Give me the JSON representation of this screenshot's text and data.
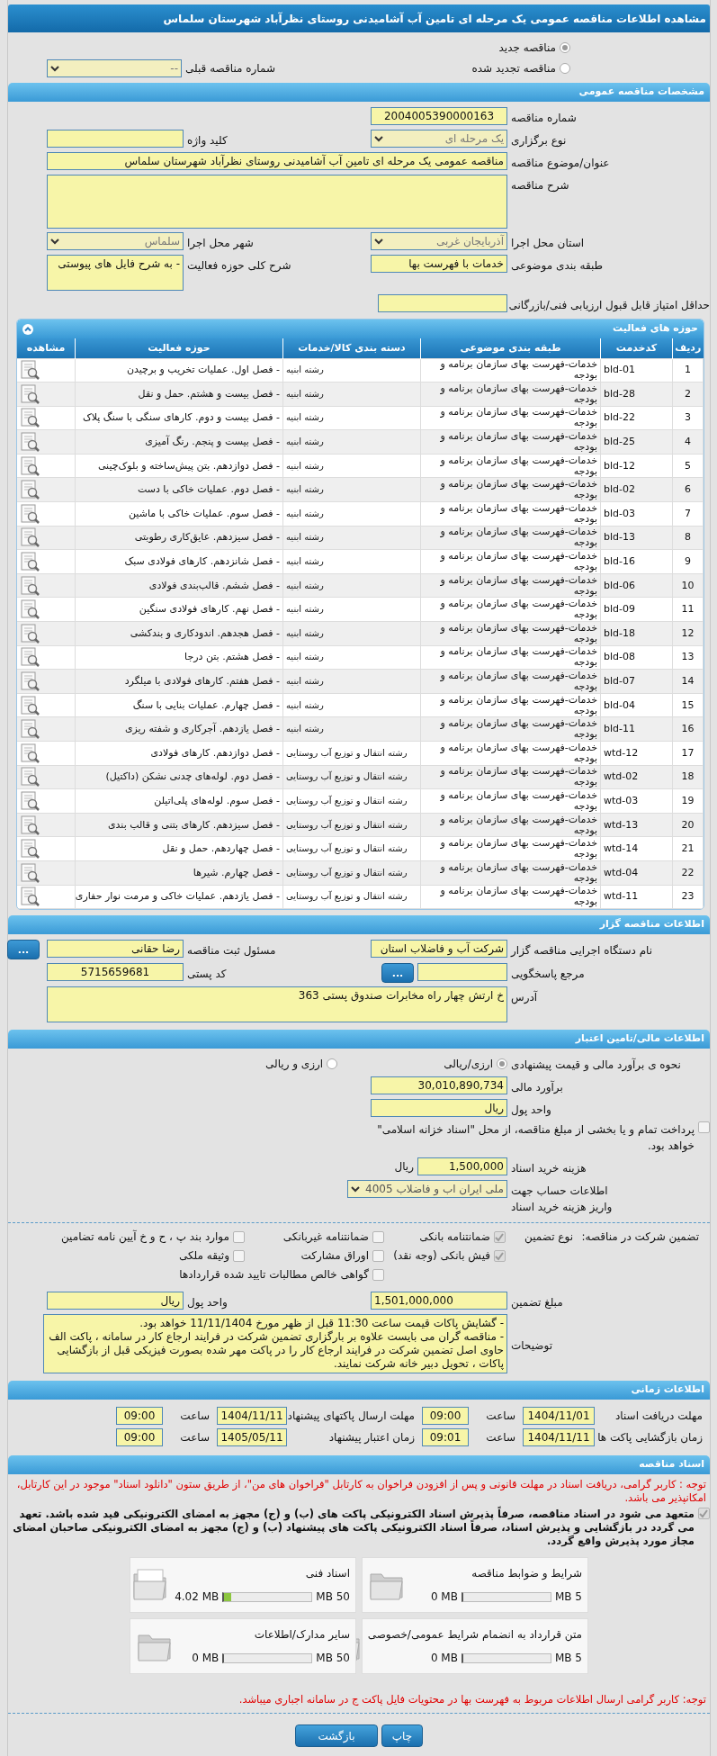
{
  "title": "مشاهده اطلاعات مناقصه عمومی یک مرحله ای تامین آب آشامیدنی روستای نظرآباد شهرستان سلماس",
  "tender_type": [
    {
      "label": "مناقصه جدید",
      "selected": true
    },
    {
      "label": "مناقصه تجدید شده",
      "selected": false
    }
  ],
  "previous_tender": {
    "label": "شماره مناقصه قبلی",
    "value": "--"
  },
  "general": {
    "header": "مشخصات مناقصه عمومی",
    "rows": [
      [
        {
          "label": "شماره مناقصه",
          "value": "2004005390000163",
          "kind": "number"
        }
      ],
      [
        {
          "label": "نوع برگزاری",
          "value": "یک مرحله ای",
          "kind": "select"
        },
        {
          "label": "کلید واژه",
          "kind": "text"
        }
      ],
      [
        {
          "label": "عنوان/موضوع مناقصه",
          "value": "مناقصه عمومی یک مرحله ای تامین آب آشامیدنی روستای نظرآباد شهرستان سلماس",
          "kind": "wide"
        }
      ],
      [
        {
          "label": "شرح مناقصه",
          "kind": "wide-area"
        }
      ],
      [
        {
          "label": "استان محل اجرا",
          "value": "آذربایجان غربی",
          "kind": "select"
        },
        {
          "label": "شهر محل اجرا",
          "value": "سلماس",
          "kind": "select"
        }
      ],
      [
        {
          "label": "طبقه بندی موضوعی",
          "value": "خدمات با فهرست بها",
          "kind": "text"
        },
        {
          "label": "شرح کلی حوزه فعالیت",
          "value": "- به شرح فایل های پیوستی",
          "kind": "area"
        }
      ],
      [
        {
          "label": "حداقل امتیاز قابل قبول ارزیابی فنی/بازرگانی",
          "kind": "long"
        }
      ]
    ]
  },
  "activities": {
    "header": "حوزه های فعالیت",
    "expanded": true,
    "columns": [
      "ردیف",
      "کدخدمت",
      "طبقه بندی موضوعی",
      "دسته بندی کالا/خدمات",
      "حوزه فعالیت",
      "مشاهده"
    ],
    "rows": [
      [
        "1",
        "bld-01",
        "خدمات-فهرست بهای سازمان برنامه و بودجه",
        "رشته ابنیه",
        "- فصل اول. عملیات تخریب و برچیدن"
      ],
      [
        "2",
        "bld-28",
        "خدمات-فهرست بهای سازمان برنامه و بودجه",
        "رشته ابنیه",
        "- فصل بیست و هشتم. حمل و نقل"
      ],
      [
        "3",
        "bld-22",
        "خدمات-فهرست بهای سازمان برنامه و بودجه",
        "رشته ابنیه",
        "- فصل بیست و دوم. کارهای سنگی با سنگ پلاک"
      ],
      [
        "4",
        "bld-25",
        "خدمات-فهرست بهای سازمان برنامه و بودجه",
        "رشته ابنیه",
        "- فصل بیست و پنجم. رنگ آمیزی"
      ],
      [
        "5",
        "bld-12",
        "خدمات-فهرست بهای سازمان برنامه و بودجه",
        "رشته ابنیه",
        "- فصل دوازدهم. بتن پیش‌ساخته و بلوک‌چینی"
      ],
      [
        "6",
        "bld-02",
        "خدمات-فهرست بهای سازمان برنامه و بودجه",
        "رشته ابنیه",
        "- فصل دوم. عملیات خاکی با دست"
      ],
      [
        "7",
        "bld-03",
        "خدمات-فهرست بهای سازمان برنامه و بودجه",
        "رشته ابنیه",
        "- فصل سوم. عملیات خاکی با ماشین"
      ],
      [
        "8",
        "bld-13",
        "خدمات-فهرست بهای سازمان برنامه و بودجه",
        "رشته ابنیه",
        "- فصل سیزدهم. عایق‌کاری رطوبتی"
      ],
      [
        "9",
        "bld-16",
        "خدمات-فهرست بهای سازمان برنامه و بودجه",
        "رشته ابنیه",
        "- فصل شانزدهم. کارهای فولادی سبک"
      ],
      [
        "10",
        "bld-06",
        "خدمات-فهرست بهای سازمان برنامه و بودجه",
        "رشته ابنیه",
        "- فصل ششم. قالب‌بندی فولادی"
      ],
      [
        "11",
        "bld-09",
        "خدمات-فهرست بهای سازمان برنامه و بودجه",
        "رشته ابنیه",
        "- فصل نهم. کارهای فولادی سنگین"
      ],
      [
        "12",
        "bld-18",
        "خدمات-فهرست بهای سازمان برنامه و بودجه",
        "رشته ابنیه",
        "- فصل هجدهم. اندودکاری و بندکشی"
      ],
      [
        "13",
        "bld-08",
        "خدمات-فهرست بهای سازمان برنامه و بودجه",
        "رشته ابنیه",
        "- فصل هشتم. بتن درجا"
      ],
      [
        "14",
        "bld-07",
        "خدمات-فهرست بهای سازمان برنامه و بودجه",
        "رشته ابنیه",
        "- فصل هفتم. کارهای فولادی با میلگرد"
      ],
      [
        "15",
        "bld-04",
        "خدمات-فهرست بهای سازمان برنامه و بودجه",
        "رشته ابنیه",
        "- فصل چهارم. عملیات بنایی با سنگ"
      ],
      [
        "16",
        "bld-11",
        "خدمات-فهرست بهای سازمان برنامه و بودجه",
        "رشته ابنیه",
        "- فصل یازدهم. آجرکاری و شفته ریزی"
      ],
      [
        "17",
        "wtd-12",
        "خدمات-فهرست بهای سازمان برنامه و بودجه",
        "رشته انتقال و توزیع آب روستایی",
        "- فصل دوازدهم. کارهای فولادی"
      ],
      [
        "18",
        "wtd-02",
        "خدمات-فهرست بهای سازمان برنامه و بودجه",
        "رشته انتقال و توزیع آب روستایی",
        "- فصل دوم. لوله‌های چدنی نشکن (داکتیل)"
      ],
      [
        "19",
        "wtd-03",
        "خدمات-فهرست بهای سازمان برنامه و بودجه",
        "رشته انتقال و توزیع آب روستایی",
        "- فصل سوم. لوله‌های پلی‌اتیلن"
      ],
      [
        "20",
        "wtd-13",
        "خدمات-فهرست بهای سازمان برنامه و بودجه",
        "رشته انتقال و توزیع آب روستایی",
        "- فصل سیزدهم. کارهای بتنی و قالب بندی"
      ],
      [
        "21",
        "wtd-14",
        "خدمات-فهرست بهای سازمان برنامه و بودجه",
        "رشته انتقال و توزیع آب روستایی",
        "- فصل چهاردهم. حمل و نقل"
      ],
      [
        "22",
        "wtd-04",
        "خدمات-فهرست بهای سازمان برنامه و بودجه",
        "رشته انتقال و توزیع آب روستایی",
        "- فصل چهارم. شیرها"
      ],
      [
        "23",
        "wtd-11",
        "خدمات-فهرست بهای سازمان برنامه و بودجه",
        "رشته انتقال و توزیع آب روستایی",
        "- فصل یازدهم. عملیات خاکی و مرمت نوار حفاری"
      ]
    ]
  },
  "organizer": {
    "header": "اطلاعات مناقصه گزار",
    "rows": [
      [
        {
          "label": "نام دستگاه اجرایی مناقصه گزار",
          "value": "شرکت آب و فاضلاب استان",
          "kind": "text"
        },
        {
          "label": "مسئول ثبت مناقصه",
          "value": "رضا حقانی",
          "kind": "text",
          "button": "..."
        }
      ],
      [
        {
          "label": "مرجع پاسخگویی",
          "kind": "short",
          "button": "..."
        },
        {
          "label": "کد پستی",
          "value": "5715659681",
          "kind": "number"
        }
      ],
      [
        {
          "label": "آدرس",
          "value": "خ ارتش چهار راه مخابرات صندوق پستی 363",
          "kind": "wide-area"
        }
      ]
    ]
  },
  "finance": {
    "header": "اطلاعات مالی/تامین اعتبار",
    "method_label": "نحوه ی برآورد مالی و قیمت پیشنهادی",
    "methods": [
      {
        "label": "ارزی/ریالی",
        "selected": true
      },
      {
        "label": "ارزی و ریالی",
        "selected": false
      }
    ],
    "estimate": {
      "label": "برآورد مالی",
      "value": "30,010,890,734"
    },
    "currency": {
      "label": "واحد پول",
      "value": "ریال"
    },
    "treasury": {
      "text": "پرداخت تمام و یا بخشی از مبلغ مناقصه، از محل \"اسناد خزانه اسلامی\" خواهد بود.",
      "checked": false
    },
    "doc_fee": {
      "label": "هزینه خرید اسناد",
      "value": "1,500,000",
      "unit": "ریال"
    },
    "account": {
      "label": "اطلاعات حساب جهت واریز هزینه خرید اسناد",
      "value": "ملی ایران اب و فاضلاب 4005"
    }
  },
  "guarantee": {
    "title": "تضمین شرکت در مناقصه:",
    "type_label": "نوع تضمین",
    "options": [
      {
        "label": "ضمانتنامه بانکی",
        "checked": true
      },
      {
        "label": "ضمانتنامه غیربانکی",
        "checked": false
      },
      {
        "label": "موارد بند پ ، ح و خ آیین نامه تضامین",
        "checked": false
      },
      {
        "label": "فیش بانکی (وجه نقد)",
        "checked": true
      },
      {
        "label": "اوراق مشارکت",
        "checked": false
      },
      {
        "label": "وثیقه ملکی",
        "checked": false
      },
      {
        "label": "گواهی خالص مطالبات تایید شده قراردادها",
        "checked": false
      }
    ],
    "amount": {
      "label": "مبلغ تضمین",
      "value": "1,501,000,000"
    },
    "currency": {
      "label": "واحد پول",
      "value": "ریال"
    },
    "notes": {
      "label": "توضیحات",
      "lines": [
        "- گشایش پاکات قیمت ساعت 11:30 قبل از ظهر مورخ 11/11/1404 خواهد بود.",
        "- مناقصه گران می بایست علاوه بر بارگزاری تضمین شرکت در فرایند ارجاع کار در سامانه ، پاکت الف حاوی اصل تضمین شرکت در فرایند ارجاع کار را در پاکت مهر شده بصورت فیزیکی قبل از بازگشایی پاکات ، تحویل دبیر خانه شرکت نمایند."
      ]
    }
  },
  "schedule": {
    "header": "اطلاعات زمانی",
    "items": [
      {
        "label": "مهلت دریافت اسناد",
        "date": "1404/11/01",
        "time_label": "ساعت",
        "time": "09:00"
      },
      {
        "label": "مهلت ارسال پاکتهای پیشنهاد",
        "date": "1404/11/11",
        "time_label": "ساعت",
        "time": "09:00"
      },
      {
        "label": "زمان بازگشایی پاکت ها",
        "date": "1404/11/11",
        "time_label": "ساعت",
        "time": "09:01"
      },
      {
        "label": "زمان اعتبار پیشنهاد",
        "date": "1405/05/11",
        "time_label": "ساعت",
        "time": "09:00"
      }
    ]
  },
  "documents": {
    "header": "اسناد مناقصه",
    "notice": "توجه : کاربر گرامی، دریافت اسناد در مهلت قانونی و پس از افزودن فراخوان به کارتابل \"فراخوان های من\"، از طریق ستون \"دانلود اسناد\" موجود در این کارتابل، امکانپذیر می باشد.",
    "commitment": {
      "text": "متعهد می شود در اسناد مناقصه، صرفاً پذیرش اسناد الکترونیکی پاکت های (ب) و (ج) مجهز به امضای الکترونیکی قید شده باشد. تعهد می گردد در بازگشایی و پذیرش اسناد، صرفاً اسناد الکترونیکی پاکت های پیشنهاد (ب) و (ج) مجهز به امضای الکترونیکی صاحبان امضای مجاز مورد پذیرش واقع گردد.",
      "checked": true
    },
    "files": [
      {
        "name": "شرایط و ضوابط مناقصه",
        "max": "5 MB",
        "used": "0 MB",
        "level": 0,
        "has_file": false
      },
      {
        "name": "اسناد فنی",
        "max": "50 MB",
        "used": "4.02 MB",
        "level": 0.08,
        "has_file": true
      },
      {
        "name": "متن قرارداد به انضمام شرایط عمومی/خصوصی",
        "max": "5 MB",
        "used": "0 MB",
        "level": 0,
        "has_file": false
      },
      {
        "name": "سایر مدارک/اطلاعات",
        "max": "50 MB",
        "used": "0 MB",
        "level": 0,
        "has_file": false
      }
    ],
    "footer_note": "توجه: کاربر گرامی ارسال اطلاعات مربوط به فهرست بها در محتویات فایل پاکت ج در سامانه اجباری میباشد."
  },
  "buttons": [
    "چاپ",
    "بازگشت"
  ]
}
